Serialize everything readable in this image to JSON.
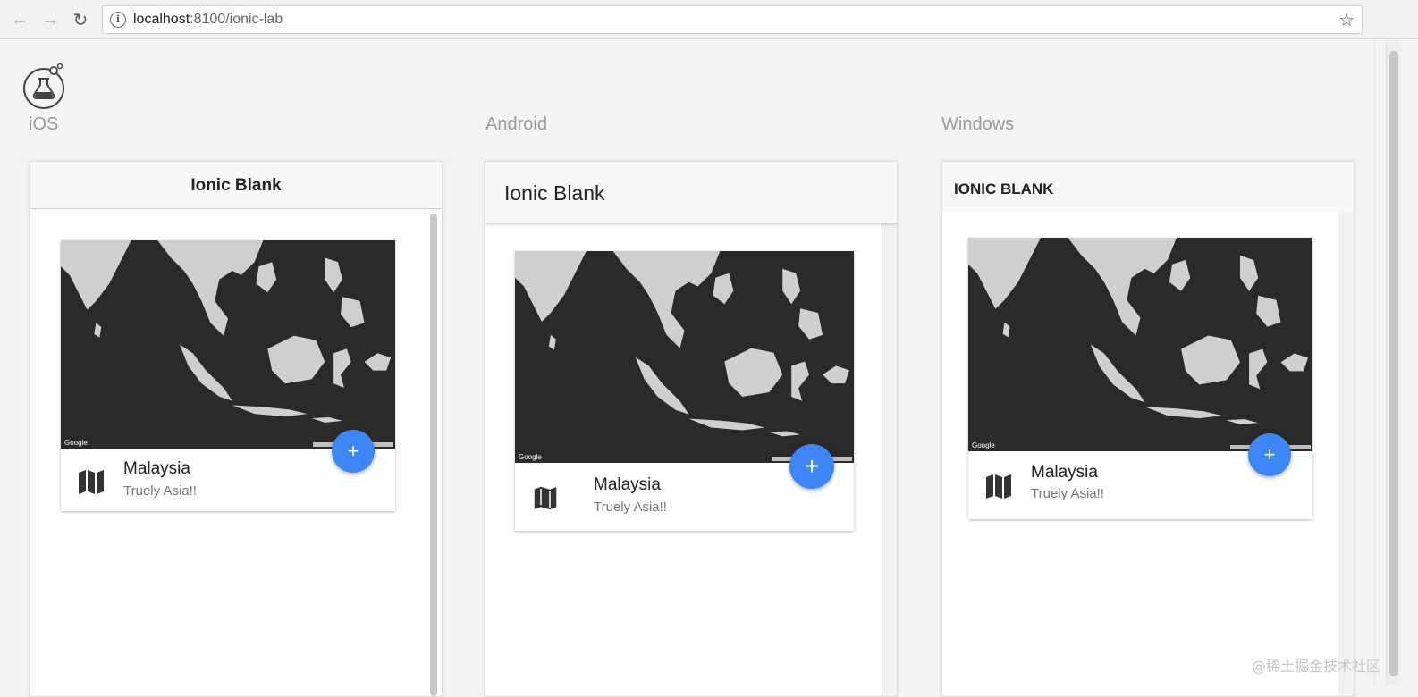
{
  "browser": {
    "url_host": "localhost",
    "url_path": ":8100/ionic-lab"
  },
  "platforms": [
    {
      "label": "iOS",
      "title": "Ionic Blank",
      "card": {
        "title": "Malaysia",
        "subtitle": "Truely Asia!!",
        "map_label": "Google",
        "fab": "+"
      }
    },
    {
      "label": "Android",
      "title": "Ionic Blank",
      "card": {
        "title": "Malaysia",
        "subtitle": "Truely Asia!!",
        "map_label": "Google",
        "fab": "+"
      }
    },
    {
      "label": "Windows",
      "title": "IONIC BLANK",
      "card": {
        "title": "Malaysia",
        "subtitle": "Truely Asia!!",
        "map_label": "Google",
        "fab": "+"
      }
    }
  ],
  "watermark": "@稀土掘金技术社区",
  "colors": {
    "fab": "#3d86f6",
    "map_sea": "#2a2a2a",
    "map_land": "#cfcfcf"
  }
}
